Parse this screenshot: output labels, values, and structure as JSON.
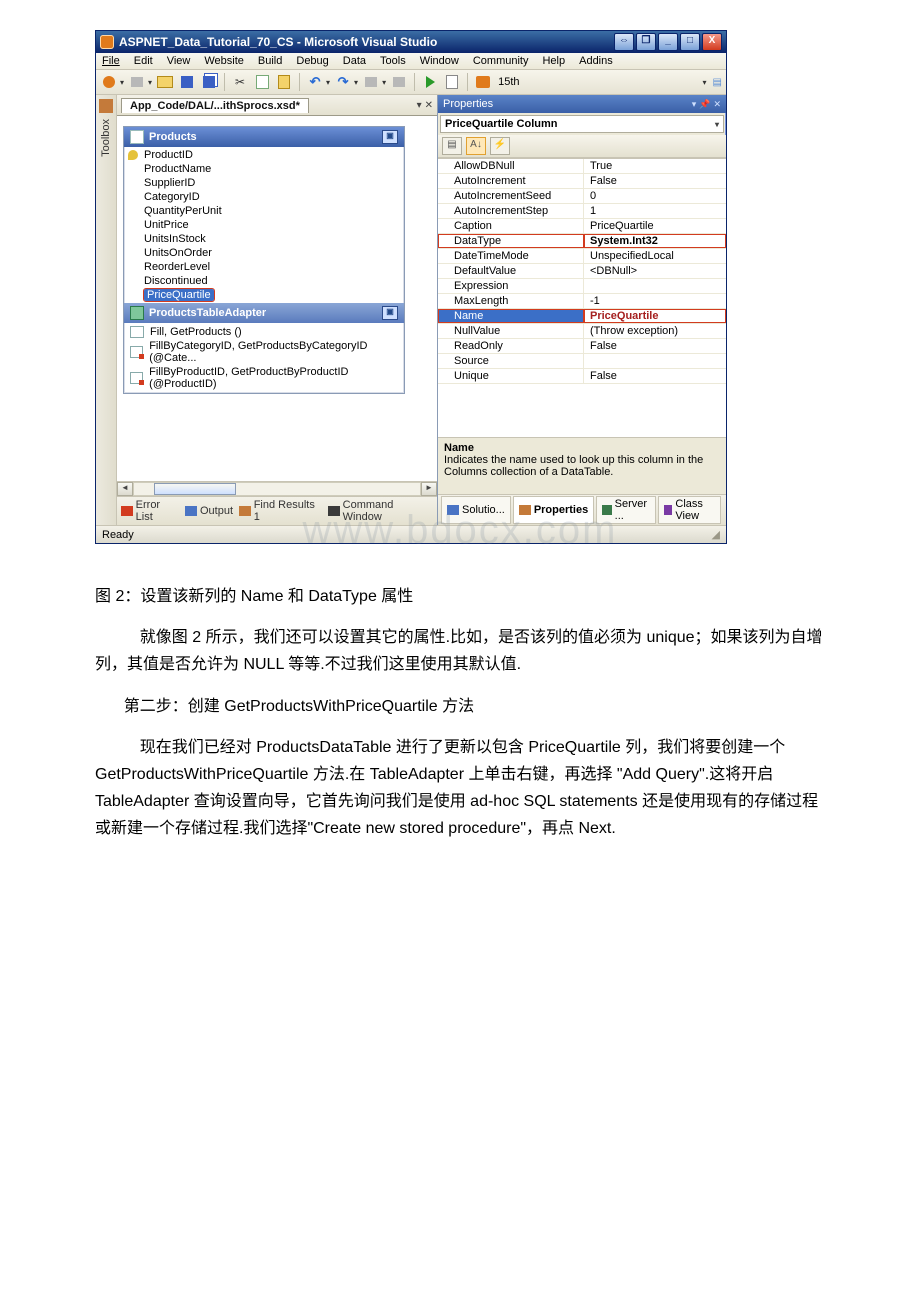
{
  "vs": {
    "title": "ASPNET_Data_Tutorial_70_CS - Microsoft Visual Studio",
    "winbtns": {
      "maxalt": "⇔",
      "restore": "❐",
      "min": "_",
      "max": "□",
      "close": "X"
    },
    "menu": [
      "File",
      "Edit",
      "View",
      "Website",
      "Build",
      "Debug",
      "Data",
      "Tools",
      "Window",
      "Community",
      "Help",
      "Addins"
    ],
    "toolbar_find_text": "15th",
    "doc_tab": "App_Code/DAL/...ithSprocs.xsd*",
    "toolbox_label": "Toolbox",
    "datatable": {
      "title": "Products",
      "columns": [
        "ProductID",
        "ProductName",
        "SupplierID",
        "CategoryID",
        "QuantityPerUnit",
        "UnitPrice",
        "UnitsInStock",
        "UnitsOnOrder",
        "ReorderLevel",
        "Discontinued",
        "PriceQuartile"
      ],
      "adapter_title": "ProductsTableAdapter",
      "adapter_rows": [
        "Fill, GetProducts ()",
        "FillByCategoryID, GetProductsByCategoryID (@Cate...",
        "FillByProductID, GetProductByProductID (@ProductID)"
      ]
    },
    "bottom_tabs": [
      "Error List",
      "Output",
      "Find Results 1",
      "Command Window"
    ],
    "properties": {
      "pane_title": "Properties",
      "combo": "PriceQuartile Column",
      "rows": [
        {
          "name": "AllowDBNull",
          "val": "True"
        },
        {
          "name": "AutoIncrement",
          "val": "False"
        },
        {
          "name": "AutoIncrementSeed",
          "val": "0"
        },
        {
          "name": "AutoIncrementStep",
          "val": "1"
        },
        {
          "name": "Caption",
          "val": "PriceQuartile"
        },
        {
          "name": "DataType",
          "val": "System.Int32",
          "hl": true,
          "bold": true
        },
        {
          "name": "DateTimeMode",
          "val": "UnspecifiedLocal"
        },
        {
          "name": "DefaultValue",
          "val": "<DBNull>"
        },
        {
          "name": "Expression",
          "val": ""
        },
        {
          "name": "MaxLength",
          "val": "-1"
        },
        {
          "name": "Name",
          "val": "PriceQuartile",
          "sel": true,
          "hl": true,
          "bold": true
        },
        {
          "name": "NullValue",
          "val": "(Throw exception)"
        },
        {
          "name": "ReadOnly",
          "val": "False"
        },
        {
          "name": "Source",
          "val": ""
        },
        {
          "name": "Unique",
          "val": "False"
        }
      ],
      "desc_title": "Name",
      "desc_text": "Indicates the name used to look up this column in the Columns collection of a DataTable."
    },
    "rb_tabs": [
      "Solutio...",
      "Properties",
      "Server ...",
      "Class View"
    ],
    "status": "Ready"
  },
  "watermark": "www.bdocx.com",
  "article": {
    "caption": "图 2：设置该新列的 Name 和 DataType 属性",
    "p1": "就像图 2 所示，我们还可以设置其它的属性.比如，是否该列的值必须为 unique；如果该列为自增列，其值是否允许为 NULL 等等.不过我们这里使用其默认值.",
    "step_title": "第二步：创建 GetProductsWithPriceQuartile 方法",
    "p2": "现在我们已经对 ProductsDataTable 进行了更新以包含 PriceQuartile 列，我们将要创建一个 GetProductsWithPriceQuartile 方法.在 TableAdapter 上单击右键，再选择 \"Add Query\".这将开启 TableAdapter 查询设置向导，它首先询问我们是使用 ad-hoc SQL statements 还是使用现有的存储过程或新建一个存储过程.我们选择\"Create new stored procedure\"，再点 Next."
  }
}
